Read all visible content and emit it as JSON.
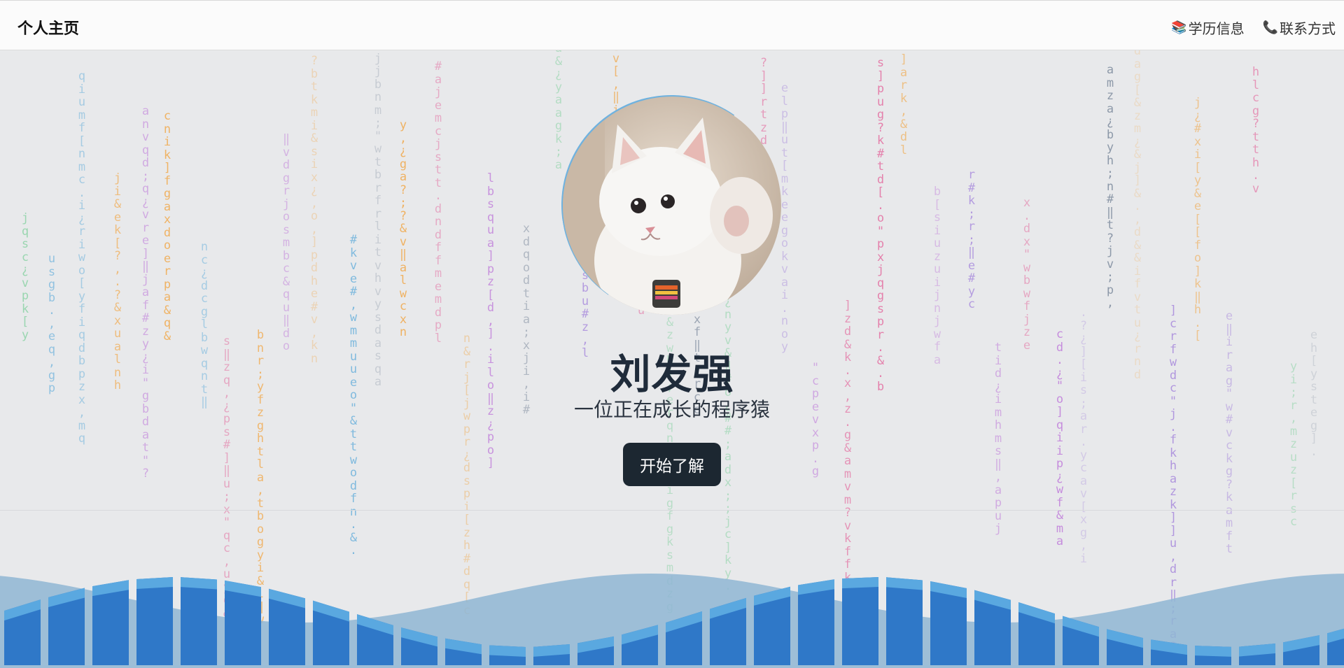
{
  "navbar": {
    "brand": "个人主页",
    "links": [
      {
        "icon": "book-stack-icon",
        "label": "学历信息"
      },
      {
        "icon": "phone-icon",
        "label": "联系方式"
      }
    ]
  },
  "hero": {
    "name": "刘发强",
    "subtitle": "一位正在成长的程序猿",
    "cta_label": "开始了解",
    "avatar_alt": "white kitten waving"
  },
  "colors": {
    "background": "#e8e9eb",
    "button": "#1c2731",
    "title": "#1f2b3a",
    "wave_front": "#2f78c8",
    "wave_top": "#5aa8e0",
    "wave_back": "#8fb6d3",
    "matrix_palette": [
      "#3cc06a",
      "#b55fd6",
      "#f39b2a",
      "#4ba3d8",
      "#5e6f86",
      "#e35a94",
      "#8b5fd6"
    ]
  }
}
